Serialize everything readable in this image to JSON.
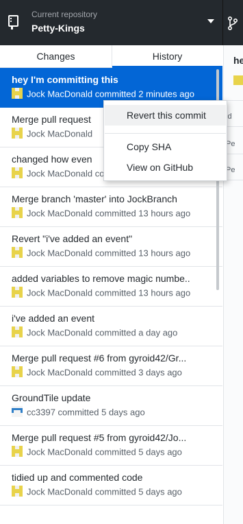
{
  "header": {
    "repo_label": "Current repository",
    "repo_name": "Petty-Kings"
  },
  "tabs": [
    {
      "label": "Changes",
      "selected": false
    },
    {
      "label": "History",
      "selected": true
    }
  ],
  "commits": [
    {
      "summary": "hey I'm committing this",
      "meta": "Jock MacDonald committed 2 minutes ago",
      "avatar": "yellow-identicon"
    },
    {
      "summary": "Merge pull request",
      "meta": "Jock MacDonald",
      "avatar": "yellow-identicon"
    },
    {
      "summary": "changed how even",
      "meta": "Jock MacDonald committed 45 minutes a...",
      "avatar": "yellow-identicon"
    },
    {
      "summary": "Merge branch 'master' into JockBranch",
      "meta": "Jock MacDonald committed 13 hours ago",
      "avatar": "yellow-identicon"
    },
    {
      "summary": "Revert \"i've added an event\"",
      "meta": "Jock MacDonald committed 13 hours ago",
      "avatar": "yellow-identicon"
    },
    {
      "summary": "added variables to remove magic numbe..",
      "meta": "Jock MacDonald committed 13 hours ago",
      "avatar": "yellow-identicon"
    },
    {
      "summary": "i've added an event",
      "meta": "Jock MacDonald committed a day ago",
      "avatar": "yellow-identicon"
    },
    {
      "summary": "Merge pull request #6 from gyroid42/Gr...",
      "meta": "Jock MacDonald committed 3 days ago",
      "avatar": "yellow-identicon"
    },
    {
      "summary": "GroundTile update",
      "meta": "cc3397 committed 5 days ago",
      "avatar": "blue-identicon"
    },
    {
      "summary": "Merge pull request #5 from gyroid42/Jo...",
      "meta": "Jock MacDonald committed 5 days ago",
      "avatar": "yellow-identicon"
    },
    {
      "summary": "tidied up and commented code",
      "meta": "Jock MacDonald committed 5 days ago",
      "avatar": "yellow-identicon"
    }
  ],
  "context_menu": {
    "revert": "Revert this commit",
    "copy_sha": "Copy SHA",
    "view_github": "View on GitHub"
  },
  "details_pane": {
    "title": "he",
    "line1": "id",
    "line2": "Pe",
    "line3": "Pe"
  },
  "colors": {
    "header_bg": "#24292e",
    "selected_row": "#0366d6",
    "avatar_yellow": "#e8d34b",
    "avatar_blue": "#2f7fc8"
  }
}
